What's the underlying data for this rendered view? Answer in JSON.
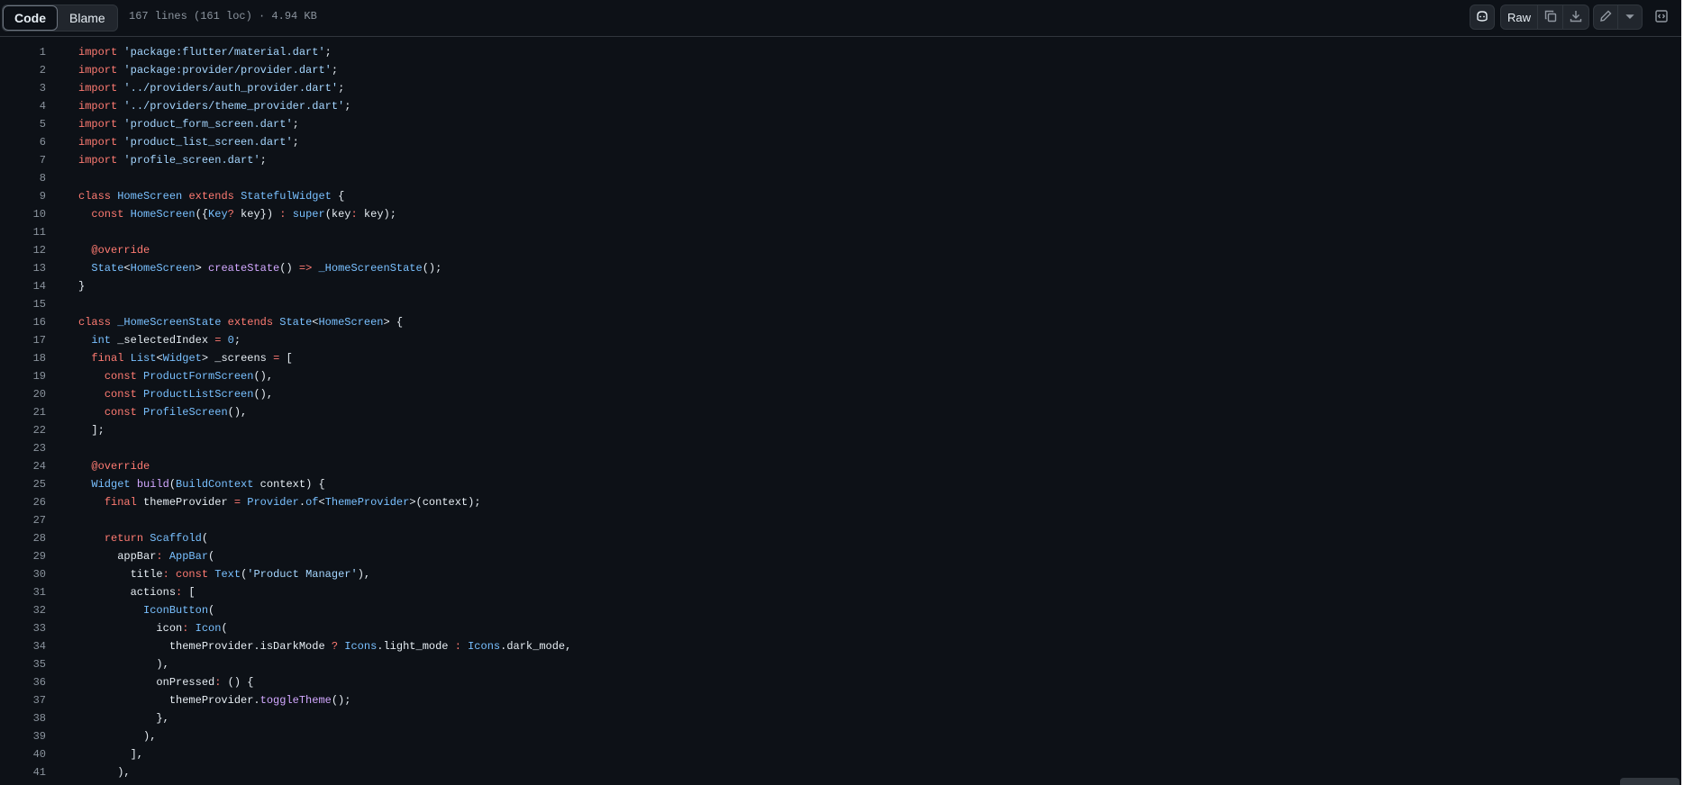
{
  "toolbar": {
    "code_tab": "Code",
    "blame_tab": "Blame",
    "file_meta": "167 lines (161 loc) · 4.94 KB",
    "raw_label": "Raw",
    "icons": {
      "copilot": "copilot-icon",
      "copy": "copy-icon",
      "download": "download-icon",
      "edit": "pencil-icon",
      "more": "triangle-down-icon",
      "symbols": "code-square-icon"
    }
  },
  "colors": {
    "background": "#0d1117",
    "keyword": "#ff7b72",
    "string": "#a5d6ff",
    "type": "#79c0ff",
    "function": "#d2a8ff",
    "line_number": "#8b949e"
  },
  "code": {
    "lines": [
      {
        "n": "1",
        "t": [
          [
            "kw",
            "import"
          ],
          [
            "p",
            " "
          ],
          [
            "str",
            "'package:flutter/material.dart'"
          ],
          [
            "p",
            ";"
          ]
        ]
      },
      {
        "n": "2",
        "t": [
          [
            "kw",
            "import"
          ],
          [
            "p",
            " "
          ],
          [
            "str",
            "'package:provider/provider.dart'"
          ],
          [
            "p",
            ";"
          ]
        ]
      },
      {
        "n": "3",
        "t": [
          [
            "kw",
            "import"
          ],
          [
            "p",
            " "
          ],
          [
            "str",
            "'../providers/auth_provider.dart'"
          ],
          [
            "p",
            ";"
          ]
        ]
      },
      {
        "n": "4",
        "t": [
          [
            "kw",
            "import"
          ],
          [
            "p",
            " "
          ],
          [
            "str",
            "'../providers/theme_provider.dart'"
          ],
          [
            "p",
            ";"
          ]
        ]
      },
      {
        "n": "5",
        "t": [
          [
            "kw",
            "import"
          ],
          [
            "p",
            " "
          ],
          [
            "str",
            "'product_form_screen.dart'"
          ],
          [
            "p",
            ";"
          ]
        ]
      },
      {
        "n": "6",
        "t": [
          [
            "kw",
            "import"
          ],
          [
            "p",
            " "
          ],
          [
            "str",
            "'product_list_screen.dart'"
          ],
          [
            "p",
            ";"
          ]
        ]
      },
      {
        "n": "7",
        "t": [
          [
            "kw",
            "import"
          ],
          [
            "p",
            " "
          ],
          [
            "str",
            "'profile_screen.dart'"
          ],
          [
            "p",
            ";"
          ]
        ]
      },
      {
        "n": "8",
        "t": []
      },
      {
        "n": "9",
        "t": [
          [
            "kw",
            "class"
          ],
          [
            "p",
            " "
          ],
          [
            "type",
            "HomeScreen"
          ],
          [
            "p",
            " "
          ],
          [
            "kw",
            "extends"
          ],
          [
            "p",
            " "
          ],
          [
            "type",
            "StatefulWidget"
          ],
          [
            "p",
            " {"
          ]
        ]
      },
      {
        "n": "10",
        "t": [
          [
            "p",
            "  "
          ],
          [
            "kw",
            "const"
          ],
          [
            "p",
            " "
          ],
          [
            "type",
            "HomeScreen"
          ],
          [
            "p",
            "({"
          ],
          [
            "type",
            "Key"
          ],
          [
            "kw",
            "?"
          ],
          [
            "p",
            " key}) "
          ],
          [
            "kw",
            ":"
          ],
          [
            "p",
            " "
          ],
          [
            "type",
            "super"
          ],
          [
            "p",
            "(key"
          ],
          [
            "kw",
            ":"
          ],
          [
            "p",
            " key);"
          ]
        ]
      },
      {
        "n": "11",
        "t": []
      },
      {
        "n": "12",
        "t": [
          [
            "p",
            "  "
          ],
          [
            "kw",
            "@override"
          ]
        ]
      },
      {
        "n": "13",
        "t": [
          [
            "p",
            "  "
          ],
          [
            "type",
            "State"
          ],
          [
            "p",
            "<"
          ],
          [
            "type",
            "HomeScreen"
          ],
          [
            "p",
            "> "
          ],
          [
            "fn",
            "createState"
          ],
          [
            "p",
            "() "
          ],
          [
            "kw",
            "=>"
          ],
          [
            "p",
            " "
          ],
          [
            "type",
            "_HomeScreenState"
          ],
          [
            "p",
            "();"
          ]
        ]
      },
      {
        "n": "14",
        "t": [
          [
            "p",
            "}"
          ]
        ]
      },
      {
        "n": "15",
        "t": []
      },
      {
        "n": "16",
        "t": [
          [
            "kw",
            "class"
          ],
          [
            "p",
            " "
          ],
          [
            "type",
            "_HomeScreenState"
          ],
          [
            "p",
            " "
          ],
          [
            "kw",
            "extends"
          ],
          [
            "p",
            " "
          ],
          [
            "type",
            "State"
          ],
          [
            "p",
            "<"
          ],
          [
            "type",
            "HomeScreen"
          ],
          [
            "p",
            "> {"
          ]
        ]
      },
      {
        "n": "17",
        "t": [
          [
            "p",
            "  "
          ],
          [
            "type",
            "int"
          ],
          [
            "p",
            " _selectedIndex "
          ],
          [
            "kw",
            "="
          ],
          [
            "p",
            " "
          ],
          [
            "num",
            "0"
          ],
          [
            "p",
            ";"
          ]
        ]
      },
      {
        "n": "18",
        "t": [
          [
            "p",
            "  "
          ],
          [
            "kw",
            "final"
          ],
          [
            "p",
            " "
          ],
          [
            "type",
            "List"
          ],
          [
            "p",
            "<"
          ],
          [
            "type",
            "Widget"
          ],
          [
            "p",
            "> _screens "
          ],
          [
            "kw",
            "="
          ],
          [
            "p",
            " ["
          ]
        ]
      },
      {
        "n": "19",
        "t": [
          [
            "p",
            "    "
          ],
          [
            "kw",
            "const"
          ],
          [
            "p",
            " "
          ],
          [
            "type",
            "ProductFormScreen"
          ],
          [
            "p",
            "(),"
          ]
        ]
      },
      {
        "n": "20",
        "t": [
          [
            "p",
            "    "
          ],
          [
            "kw",
            "const"
          ],
          [
            "p",
            " "
          ],
          [
            "type",
            "ProductListScreen"
          ],
          [
            "p",
            "(),"
          ]
        ]
      },
      {
        "n": "21",
        "t": [
          [
            "p",
            "    "
          ],
          [
            "kw",
            "const"
          ],
          [
            "p",
            " "
          ],
          [
            "type",
            "ProfileScreen"
          ],
          [
            "p",
            "(),"
          ]
        ]
      },
      {
        "n": "22",
        "t": [
          [
            "p",
            "  ];"
          ]
        ]
      },
      {
        "n": "23",
        "t": []
      },
      {
        "n": "24",
        "t": [
          [
            "p",
            "  "
          ],
          [
            "kw",
            "@override"
          ]
        ]
      },
      {
        "n": "25",
        "t": [
          [
            "p",
            "  "
          ],
          [
            "type",
            "Widget"
          ],
          [
            "p",
            " "
          ],
          [
            "fn",
            "build"
          ],
          [
            "p",
            "("
          ],
          [
            "type",
            "BuildContext"
          ],
          [
            "p",
            " context) {"
          ]
        ]
      },
      {
        "n": "26",
        "t": [
          [
            "p",
            "    "
          ],
          [
            "kw",
            "final"
          ],
          [
            "p",
            " themeProvider "
          ],
          [
            "kw",
            "="
          ],
          [
            "p",
            " "
          ],
          [
            "type",
            "Provider"
          ],
          [
            "p",
            "."
          ],
          [
            "type",
            "of"
          ],
          [
            "p",
            "<"
          ],
          [
            "type",
            "ThemeProvider"
          ],
          [
            "p",
            ">(context);"
          ]
        ]
      },
      {
        "n": "27",
        "t": []
      },
      {
        "n": "28",
        "t": [
          [
            "p",
            "    "
          ],
          [
            "kw",
            "return"
          ],
          [
            "p",
            " "
          ],
          [
            "type",
            "Scaffold"
          ],
          [
            "p",
            "("
          ]
        ]
      },
      {
        "n": "29",
        "t": [
          [
            "p",
            "      appBar"
          ],
          [
            "kw",
            ":"
          ],
          [
            "p",
            " "
          ],
          [
            "type",
            "AppBar"
          ],
          [
            "p",
            "("
          ]
        ]
      },
      {
        "n": "30",
        "t": [
          [
            "p",
            "        title"
          ],
          [
            "kw",
            ":"
          ],
          [
            "p",
            " "
          ],
          [
            "kw",
            "const"
          ],
          [
            "p",
            " "
          ],
          [
            "type",
            "Text"
          ],
          [
            "p",
            "("
          ],
          [
            "str",
            "'Product Manager'"
          ],
          [
            "p",
            "),"
          ]
        ]
      },
      {
        "n": "31",
        "t": [
          [
            "p",
            "        actions"
          ],
          [
            "kw",
            ":"
          ],
          [
            "p",
            " ["
          ]
        ]
      },
      {
        "n": "32",
        "t": [
          [
            "p",
            "          "
          ],
          [
            "type",
            "IconButton"
          ],
          [
            "p",
            "("
          ]
        ]
      },
      {
        "n": "33",
        "t": [
          [
            "p",
            "            icon"
          ],
          [
            "kw",
            ":"
          ],
          [
            "p",
            " "
          ],
          [
            "type",
            "Icon"
          ],
          [
            "p",
            "("
          ]
        ]
      },
      {
        "n": "34",
        "t": [
          [
            "p",
            "              themeProvider.isDarkMode "
          ],
          [
            "kw",
            "?"
          ],
          [
            "p",
            " "
          ],
          [
            "type",
            "Icons"
          ],
          [
            "p",
            ".light_mode "
          ],
          [
            "kw",
            ":"
          ],
          [
            "p",
            " "
          ],
          [
            "type",
            "Icons"
          ],
          [
            "p",
            ".dark_mode,"
          ]
        ]
      },
      {
        "n": "35",
        "t": [
          [
            "p",
            "            ),"
          ]
        ]
      },
      {
        "n": "36",
        "t": [
          [
            "p",
            "            onPressed"
          ],
          [
            "kw",
            ":"
          ],
          [
            "p",
            " () {"
          ]
        ]
      },
      {
        "n": "37",
        "t": [
          [
            "p",
            "              themeProvider."
          ],
          [
            "fn",
            "toggleTheme"
          ],
          [
            "p",
            "();"
          ]
        ]
      },
      {
        "n": "38",
        "t": [
          [
            "p",
            "            },"
          ]
        ]
      },
      {
        "n": "39",
        "t": [
          [
            "p",
            "          ),"
          ]
        ]
      },
      {
        "n": "40",
        "t": [
          [
            "p",
            "        ],"
          ]
        ]
      },
      {
        "n": "41",
        "t": [
          [
            "p",
            "      ),"
          ]
        ]
      }
    ]
  }
}
